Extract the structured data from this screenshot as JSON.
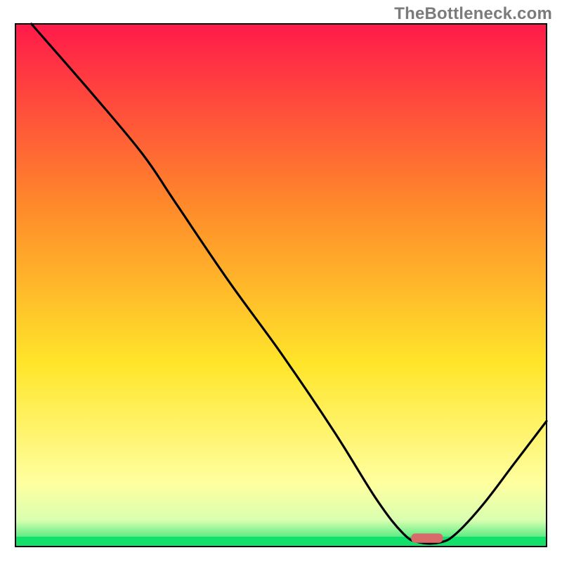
{
  "watermark": "TheBottleneck.com",
  "chart_data": {
    "type": "line",
    "title": "",
    "xlabel": "",
    "ylabel": "",
    "xlim": [
      0,
      100
    ],
    "ylim": [
      0,
      100
    ],
    "grid": false,
    "legend": false,
    "background_gradient": {
      "top_color": "#ff1a4a",
      "mid_color_1": "#ff8a2a",
      "mid_color_2": "#ffe52a",
      "lower_color": "#ffffa0",
      "bottom_band_color": "#13e06a"
    },
    "curve": {
      "description": "Black valley curve — descends from top-left, reaches minimum near x≈78, rises to right edge",
      "approx_points_percent": [
        {
          "x": 3.0,
          "y": 100.0
        },
        {
          "x": 15.0,
          "y": 86.0
        },
        {
          "x": 24.0,
          "y": 75.0
        },
        {
          "x": 30.0,
          "y": 66.0
        },
        {
          "x": 40.0,
          "y": 51.0
        },
        {
          "x": 50.0,
          "y": 37.0
        },
        {
          "x": 60.0,
          "y": 22.0
        },
        {
          "x": 68.0,
          "y": 9.0
        },
        {
          "x": 73.0,
          "y": 2.5
        },
        {
          "x": 76.0,
          "y": 0.8
        },
        {
          "x": 80.0,
          "y": 0.8
        },
        {
          "x": 83.0,
          "y": 2.5
        },
        {
          "x": 88.0,
          "y": 8.0
        },
        {
          "x": 94.0,
          "y": 16.0
        },
        {
          "x": 100.0,
          "y": 24.0
        }
      ]
    },
    "marker": {
      "shape": "rounded-rect",
      "color": "#d86a6a",
      "x_percent": 77.5,
      "y_percent": 1.6,
      "width_percent": 6.0,
      "height_percent": 1.8
    },
    "plot_frame": {
      "stroke": "#000000",
      "stroke_width": 2
    }
  }
}
